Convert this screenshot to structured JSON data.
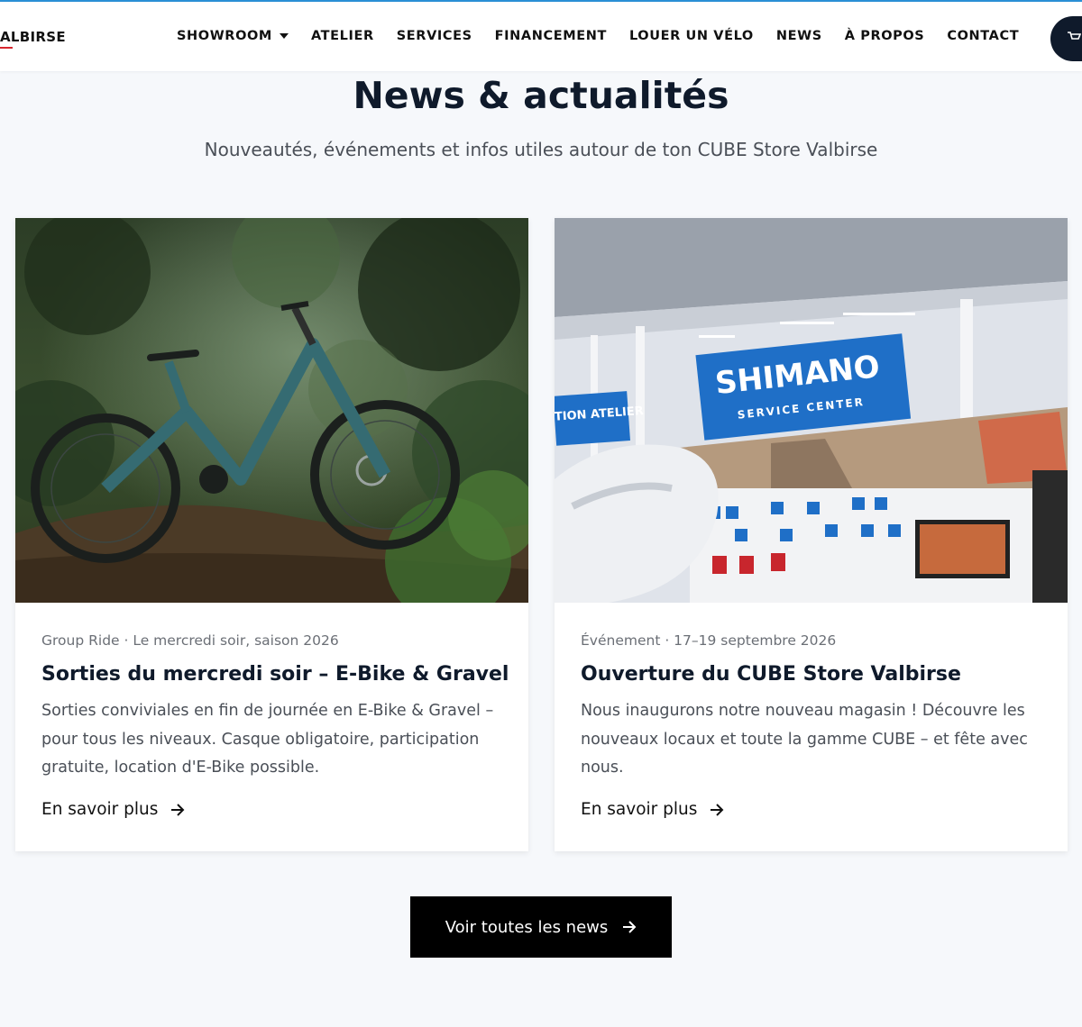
{
  "header": {
    "logo_text": "ALBIRSE",
    "nav": [
      {
        "label": "SHOWROOM",
        "has_dropdown": true
      },
      {
        "label": "ATELIER"
      },
      {
        "label": "SERVICES"
      },
      {
        "label": "FINANCEMENT"
      },
      {
        "label": "LOUER UN VÉLO"
      },
      {
        "label": "NEWS"
      },
      {
        "label": "À PROPOS"
      },
      {
        "label": "CONTACT"
      }
    ],
    "cart_icon": "cart-icon"
  },
  "section": {
    "title": "News & actualités",
    "subtitle": "Nouveautés, événements et infos utiles autour de ton CUBE Store Valbirse"
  },
  "cards": [
    {
      "image": "forest-ebike-photo",
      "meta": "Group Ride · Le mercredi soir, saison 2026",
      "title": "Sorties du mercredi soir – E-Bike & Gravel",
      "excerpt": "Sorties conviviales en fin de journée en E-Bike & Gravel – pour tous les niveaux. Casque obligatoire, participation gratuite, location d'E-Bike possible.",
      "link_label": "En savoir plus"
    },
    {
      "image": "shimano-service-center-photo",
      "image_sign_main": "SHIMANO",
      "image_sign_sub": "SERVICE CENTER",
      "image_sign_side": "TION ATELIER",
      "meta": "Événement · 17–19 septembre 2026",
      "title": "Ouverture du CUBE Store Valbirse",
      "excerpt": "Nous inaugurons notre nouveau magasin ! Découvre les nouveaux locaux et toute la gamme CUBE – et fête avec nous.",
      "link_label": "En savoir plus"
    }
  ],
  "cta": {
    "label": "Voir toutes les news"
  },
  "colors": {
    "accent_top": "#2a8fd6",
    "dark": "#0f1a2b",
    "button_bg": "#000000",
    "logo_red": "#d7262e",
    "shimano_blue": "#1f6fc7"
  }
}
